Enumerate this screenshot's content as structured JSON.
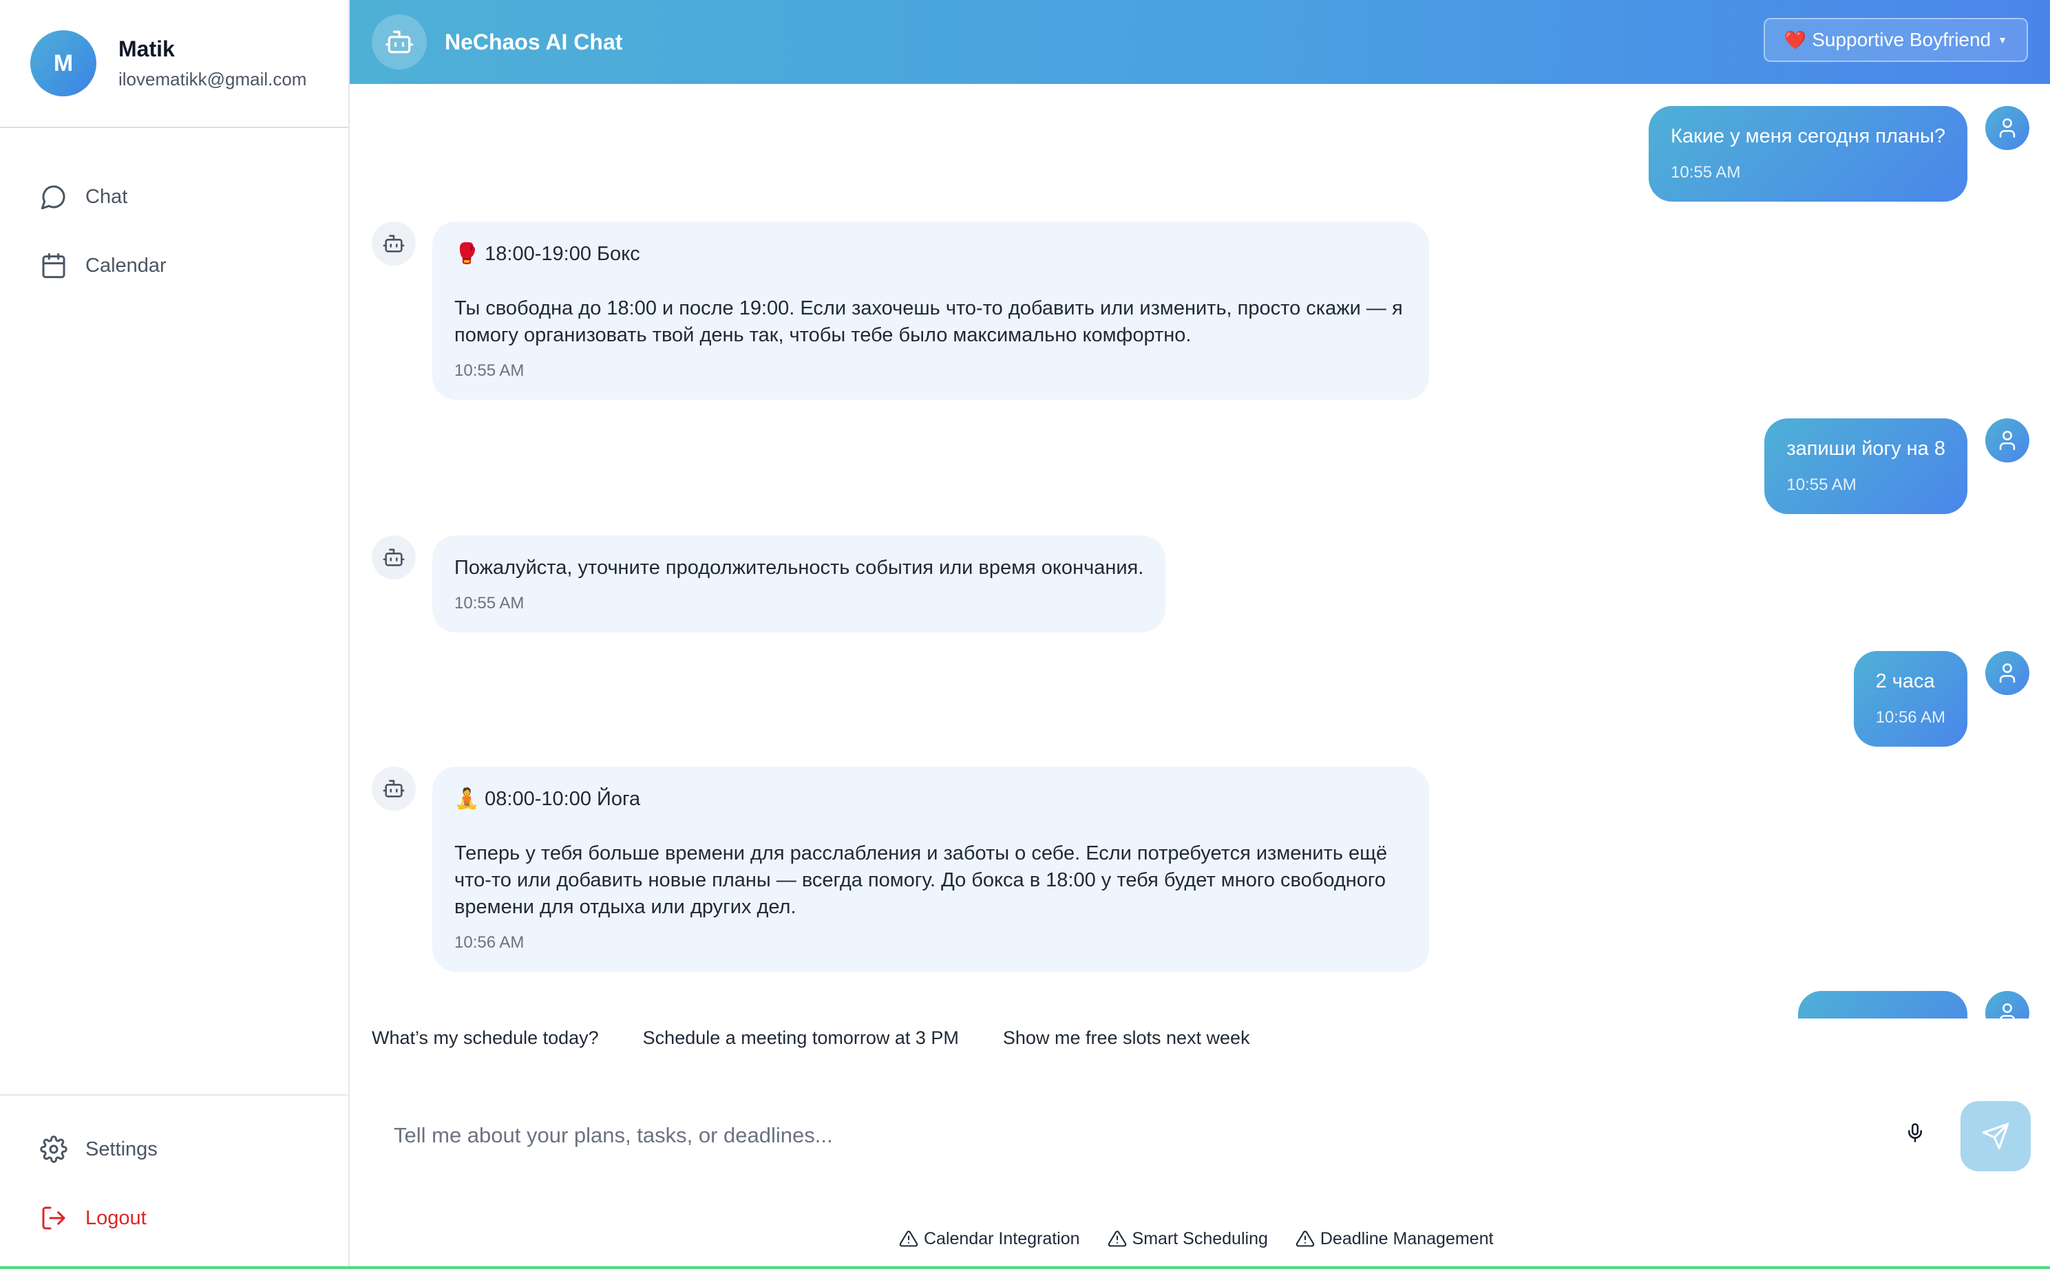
{
  "profile": {
    "initial": "M",
    "name": "Matik",
    "email": "ilovematikk@gmail.com"
  },
  "nav": {
    "chat": "Chat",
    "calendar": "Calendar",
    "settings": "Settings",
    "logout": "Logout"
  },
  "header": {
    "title": "NeChaos AI Chat",
    "mode_label": "Supportive Boyfriend",
    "mode_emoji": "❤️"
  },
  "messages": [
    {
      "role": "user",
      "text": "Какие у меня сегодня планы?",
      "time": "10:55 AM"
    },
    {
      "role": "assistant",
      "event_emoji": "🥊",
      "event": "18:00-19:00 Бокс",
      "lines": [
        "Ты свободна до 18:00 и после 19:00. Если захочешь что-то добавить или изменить, просто скажи — я",
        "помогу организовать твой день так, чтобы тебе было максимально комфортно."
      ],
      "time": "10:55 AM"
    },
    {
      "role": "user",
      "text": "запиши йогу на 8",
      "time": "10:55 AM"
    },
    {
      "role": "assistant",
      "text": "Пожалуйста, уточните продолжительность события или время окончания.",
      "time": "10:55 AM"
    },
    {
      "role": "user",
      "text": "2 часа",
      "time": "10:56 AM"
    },
    {
      "role": "assistant",
      "event_emoji": "🧘",
      "event": "08:00-10:00 Йога",
      "lines": [
        "Теперь у тебя больше времени для расслабления и заботы о себе. Если потребуется изменить ещё",
        "что-то или добавить новые планы — всегда помогу. До бокса в 18:00 у тебя будет много свободного",
        "времени для отдыха или других дел."
      ],
      "time": "10:56 AM"
    }
  ],
  "suggestions": [
    "What’s my schedule today?",
    "Schedule a meeting tomorrow at 3 PM",
    "Show me free slots next week"
  ],
  "input": {
    "placeholder": "Tell me about your plans, tasks, or deadlines..."
  },
  "features": [
    "Calendar Integration",
    "Smart Scheduling",
    "Deadline Management"
  ],
  "colors": {
    "accent_start": "#4fb0d6",
    "accent_end": "#4a86ea",
    "bot_bubble": "#eef5fd",
    "logout": "#dc2626"
  }
}
